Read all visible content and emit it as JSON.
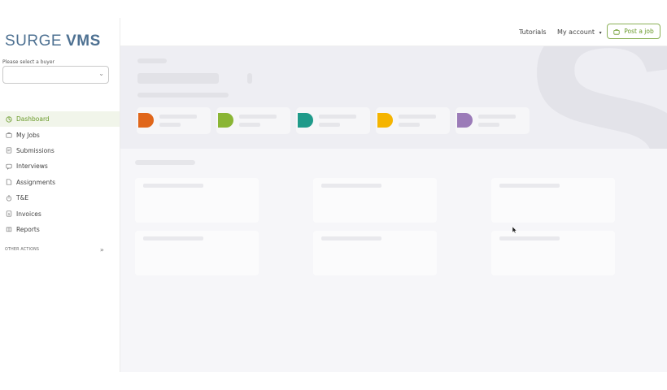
{
  "brand": {
    "logo_light": "SURGE",
    "logo_bold": "VMS"
  },
  "buyer": {
    "label": "Please select a buyer",
    "selected": ""
  },
  "nav": [
    {
      "label": "Dashboard",
      "icon": "dashboard-icon",
      "active": true
    },
    {
      "label": "My Jobs",
      "icon": "briefcase-icon",
      "active": false
    },
    {
      "label": "Submissions",
      "icon": "document-icon",
      "active": false
    },
    {
      "label": "Interviews",
      "icon": "chat-icon",
      "active": false
    },
    {
      "label": "Assignments",
      "icon": "assignment-icon",
      "active": false
    },
    {
      "label": "T&E",
      "icon": "stopwatch-icon",
      "active": false
    },
    {
      "label": "Invoices",
      "icon": "invoice-icon",
      "active": false
    },
    {
      "label": "Reports",
      "icon": "report-icon",
      "active": false
    }
  ],
  "other_actions": {
    "label": "OTHER ACTIONS",
    "icon": "double-chevron-down-icon"
  },
  "topbar": {
    "tutorials": "Tutorials",
    "my_account": "My account",
    "post_job": "Post a job",
    "post_job_icon": "briefcase-icon"
  },
  "colors": {
    "brand": "#4e7192",
    "accent": "#8cb158",
    "stat_tabs": [
      "#e0661a",
      "#8ab535",
      "#1f9a8a",
      "#f5b400",
      "#9b7bb8"
    ]
  }
}
